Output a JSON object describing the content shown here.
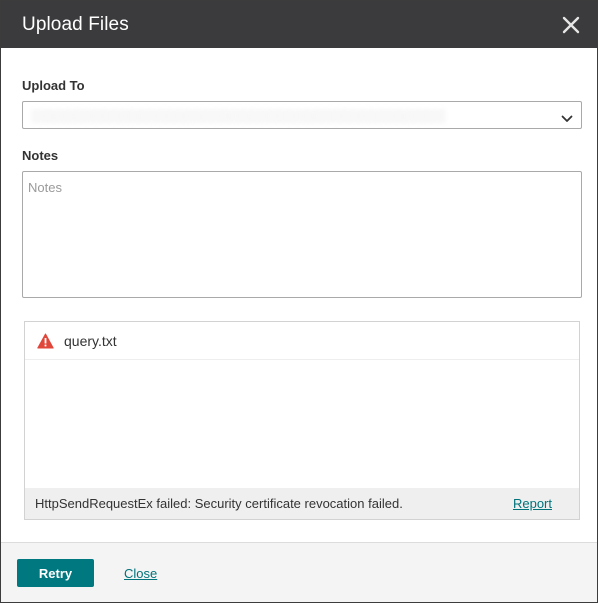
{
  "dialog": {
    "title": "Upload Files",
    "close_icon": "close-icon"
  },
  "upload_to": {
    "label": "Upload To",
    "selected_value": "░░░░░░░░░░░░░░░░░░░░░░░░░░░░░░░░░░░░░░░░░░░░░",
    "icon": "chevron-down-icon"
  },
  "notes": {
    "label": "Notes",
    "placeholder": "Notes",
    "value": ""
  },
  "files": {
    "items": [
      {
        "name": "query.txt",
        "status_icon": "warning-icon"
      }
    ],
    "status_message": "HttpSendRequestEx failed: Security certificate revocation failed.",
    "report_label": "Report"
  },
  "footer": {
    "retry_label": "Retry",
    "close_label": "Close"
  },
  "colors": {
    "titlebar": "#3b3b3d",
    "primary": "#00787f",
    "link": "#00737a",
    "warning": "#e0463a"
  }
}
